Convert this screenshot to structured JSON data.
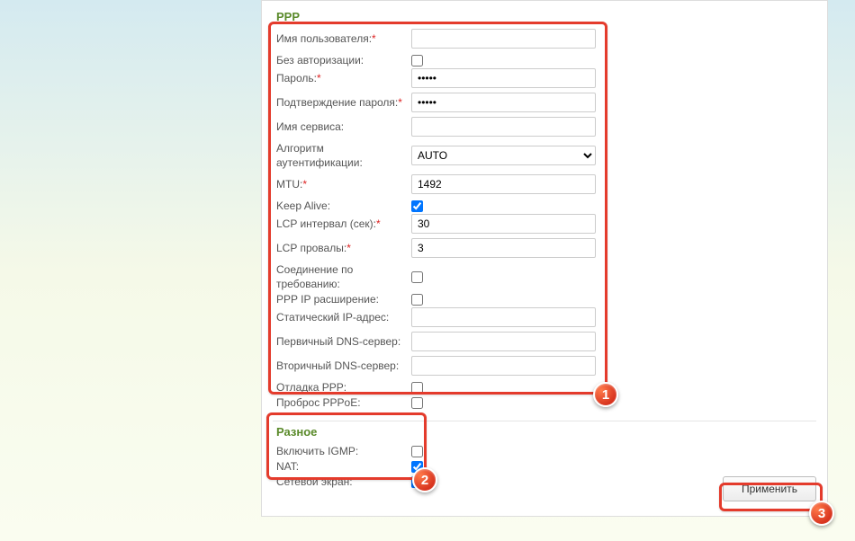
{
  "ppp": {
    "title": "PPP",
    "fields": {
      "username_label": "Имя пользователя:",
      "username_value": "",
      "noauth_label": "Без авторизации:",
      "noauth_checked": false,
      "password_label": "Пароль:",
      "password_value": "•••••",
      "password_confirm_label": "Подтверждение пароля:",
      "password_confirm_value": "•••••",
      "service_name_label": "Имя сервиса:",
      "service_name_value": "",
      "auth_algo_label": "Алгоритм аутентификации:",
      "auth_algo_value": "AUTO",
      "mtu_label": "MTU:",
      "mtu_value": "1492",
      "keepalive_label": "Keep Alive:",
      "keepalive_checked": true,
      "lcp_interval_label": "LCP интервал (сек):",
      "lcp_interval_value": "30",
      "lcp_fail_label": "LCP провалы:",
      "lcp_fail_value": "3",
      "dial_on_demand_label": "Соединение по требованию:",
      "dial_on_demand_checked": false,
      "ppp_ip_ext_label": "PPP IP расширение:",
      "ppp_ip_ext_checked": false,
      "static_ip_label": "Статический IP-адрес:",
      "static_ip_value": "",
      "dns1_label": "Первичный DNS-сервер:",
      "dns1_value": "",
      "dns2_label": "Вторичный DNS-сервер:",
      "dns2_value": "",
      "debug_label": "Отладка PPP:",
      "debug_checked": false,
      "pppoe_pass_label": "Проброс PPPoE:",
      "pppoe_pass_checked": false
    }
  },
  "misc": {
    "title": "Разное",
    "fields": {
      "igmp_label": "Включить IGMP:",
      "igmp_checked": false,
      "nat_label": "NAT:",
      "nat_checked": true,
      "firewall_label": "Сетевой экран:",
      "firewall_checked": true
    }
  },
  "footer": {
    "apply_label": "Применить"
  },
  "markers": {
    "m1": "1",
    "m2": "2",
    "m3": "3"
  },
  "colors": {
    "highlight": "#e43b2c",
    "title": "#5a8a2a"
  }
}
